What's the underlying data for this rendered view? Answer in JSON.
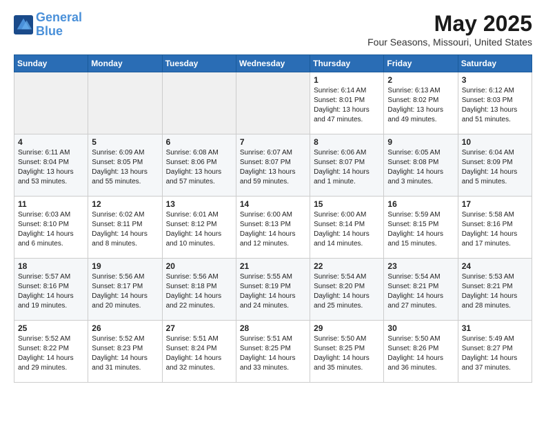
{
  "header": {
    "logo_line1": "General",
    "logo_line2": "Blue",
    "title": "May 2025",
    "subtitle": "Four Seasons, Missouri, United States"
  },
  "days_of_week": [
    "Sunday",
    "Monday",
    "Tuesday",
    "Wednesday",
    "Thursday",
    "Friday",
    "Saturday"
  ],
  "weeks": [
    [
      {
        "day": "",
        "info": ""
      },
      {
        "day": "",
        "info": ""
      },
      {
        "day": "",
        "info": ""
      },
      {
        "day": "",
        "info": ""
      },
      {
        "day": "1",
        "info": "Sunrise: 6:14 AM\nSunset: 8:01 PM\nDaylight: 13 hours\nand 47 minutes."
      },
      {
        "day": "2",
        "info": "Sunrise: 6:13 AM\nSunset: 8:02 PM\nDaylight: 13 hours\nand 49 minutes."
      },
      {
        "day": "3",
        "info": "Sunrise: 6:12 AM\nSunset: 8:03 PM\nDaylight: 13 hours\nand 51 minutes."
      }
    ],
    [
      {
        "day": "4",
        "info": "Sunrise: 6:11 AM\nSunset: 8:04 PM\nDaylight: 13 hours\nand 53 minutes."
      },
      {
        "day": "5",
        "info": "Sunrise: 6:09 AM\nSunset: 8:05 PM\nDaylight: 13 hours\nand 55 minutes."
      },
      {
        "day": "6",
        "info": "Sunrise: 6:08 AM\nSunset: 8:06 PM\nDaylight: 13 hours\nand 57 minutes."
      },
      {
        "day": "7",
        "info": "Sunrise: 6:07 AM\nSunset: 8:07 PM\nDaylight: 13 hours\nand 59 minutes."
      },
      {
        "day": "8",
        "info": "Sunrise: 6:06 AM\nSunset: 8:07 PM\nDaylight: 14 hours\nand 1 minute."
      },
      {
        "day": "9",
        "info": "Sunrise: 6:05 AM\nSunset: 8:08 PM\nDaylight: 14 hours\nand 3 minutes."
      },
      {
        "day": "10",
        "info": "Sunrise: 6:04 AM\nSunset: 8:09 PM\nDaylight: 14 hours\nand 5 minutes."
      }
    ],
    [
      {
        "day": "11",
        "info": "Sunrise: 6:03 AM\nSunset: 8:10 PM\nDaylight: 14 hours\nand 6 minutes."
      },
      {
        "day": "12",
        "info": "Sunrise: 6:02 AM\nSunset: 8:11 PM\nDaylight: 14 hours\nand 8 minutes."
      },
      {
        "day": "13",
        "info": "Sunrise: 6:01 AM\nSunset: 8:12 PM\nDaylight: 14 hours\nand 10 minutes."
      },
      {
        "day": "14",
        "info": "Sunrise: 6:00 AM\nSunset: 8:13 PM\nDaylight: 14 hours\nand 12 minutes."
      },
      {
        "day": "15",
        "info": "Sunrise: 6:00 AM\nSunset: 8:14 PM\nDaylight: 14 hours\nand 14 minutes."
      },
      {
        "day": "16",
        "info": "Sunrise: 5:59 AM\nSunset: 8:15 PM\nDaylight: 14 hours\nand 15 minutes."
      },
      {
        "day": "17",
        "info": "Sunrise: 5:58 AM\nSunset: 8:16 PM\nDaylight: 14 hours\nand 17 minutes."
      }
    ],
    [
      {
        "day": "18",
        "info": "Sunrise: 5:57 AM\nSunset: 8:16 PM\nDaylight: 14 hours\nand 19 minutes."
      },
      {
        "day": "19",
        "info": "Sunrise: 5:56 AM\nSunset: 8:17 PM\nDaylight: 14 hours\nand 20 minutes."
      },
      {
        "day": "20",
        "info": "Sunrise: 5:56 AM\nSunset: 8:18 PM\nDaylight: 14 hours\nand 22 minutes."
      },
      {
        "day": "21",
        "info": "Sunrise: 5:55 AM\nSunset: 8:19 PM\nDaylight: 14 hours\nand 24 minutes."
      },
      {
        "day": "22",
        "info": "Sunrise: 5:54 AM\nSunset: 8:20 PM\nDaylight: 14 hours\nand 25 minutes."
      },
      {
        "day": "23",
        "info": "Sunrise: 5:54 AM\nSunset: 8:21 PM\nDaylight: 14 hours\nand 27 minutes."
      },
      {
        "day": "24",
        "info": "Sunrise: 5:53 AM\nSunset: 8:21 PM\nDaylight: 14 hours\nand 28 minutes."
      }
    ],
    [
      {
        "day": "25",
        "info": "Sunrise: 5:52 AM\nSunset: 8:22 PM\nDaylight: 14 hours\nand 29 minutes."
      },
      {
        "day": "26",
        "info": "Sunrise: 5:52 AM\nSunset: 8:23 PM\nDaylight: 14 hours\nand 31 minutes."
      },
      {
        "day": "27",
        "info": "Sunrise: 5:51 AM\nSunset: 8:24 PM\nDaylight: 14 hours\nand 32 minutes."
      },
      {
        "day": "28",
        "info": "Sunrise: 5:51 AM\nSunset: 8:25 PM\nDaylight: 14 hours\nand 33 minutes."
      },
      {
        "day": "29",
        "info": "Sunrise: 5:50 AM\nSunset: 8:25 PM\nDaylight: 14 hours\nand 35 minutes."
      },
      {
        "day": "30",
        "info": "Sunrise: 5:50 AM\nSunset: 8:26 PM\nDaylight: 14 hours\nand 36 minutes."
      },
      {
        "day": "31",
        "info": "Sunrise: 5:49 AM\nSunset: 8:27 PM\nDaylight: 14 hours\nand 37 minutes."
      }
    ]
  ]
}
